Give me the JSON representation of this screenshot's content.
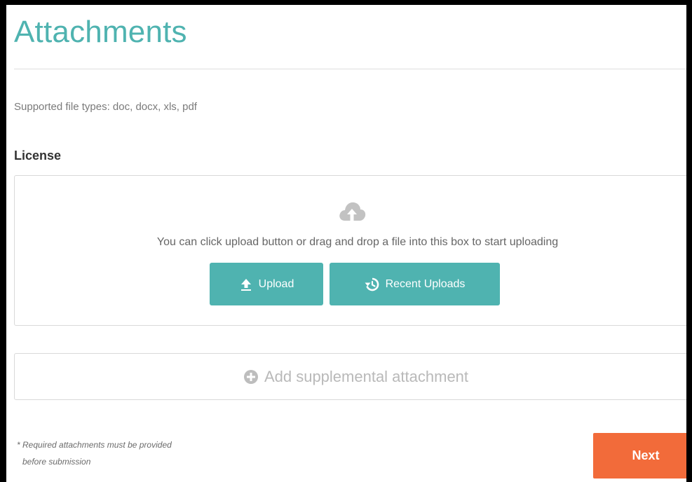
{
  "header": {
    "title": "Attachments"
  },
  "info": {
    "file_types": "Supported file types: doc, docx, xls, pdf"
  },
  "license": {
    "label": "License",
    "hint": "You can click upload button or drag and drop a file into this box to start uploading",
    "upload_label": "Upload",
    "recent_label": "Recent Uploads"
  },
  "supplemental": {
    "label": "Add supplemental attachment"
  },
  "footer": {
    "note_line1": "* Required attachments must be provided",
    "note_line2": "before submission",
    "next_label": "Next"
  },
  "icons": {
    "cloud": "cloud-upload-icon",
    "upload": "upload-arrow-icon",
    "recent": "history-icon",
    "add": "plus-circle-icon"
  },
  "colors": {
    "accent": "#4fb3b0",
    "next": "#f26b3a",
    "border": "#d9d9d9"
  }
}
